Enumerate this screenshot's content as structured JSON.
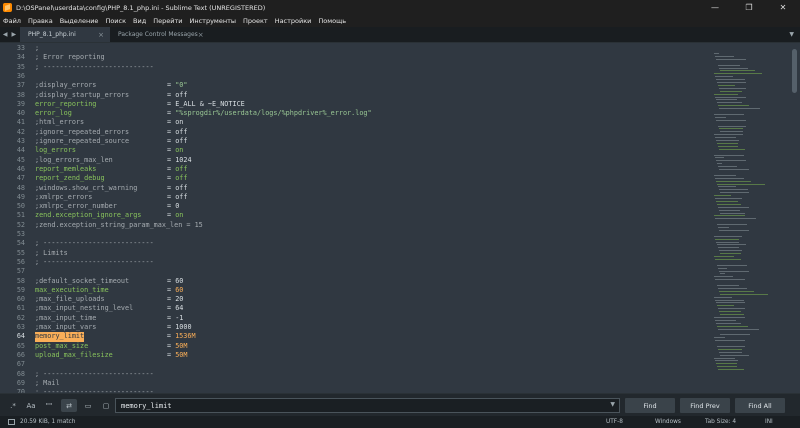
{
  "window": {
    "title": "D:\\OSPanel\\userdata\\config\\PHP_8.1_php.ini - Sublime Text (UNREGISTERED)",
    "controls": [
      "—",
      "❐",
      "✕"
    ]
  },
  "menu": [
    "Файл",
    "Правка",
    "Выделение",
    "Поиск",
    "Вид",
    "Перейти",
    "Инструменты",
    "Проект",
    "Настройки",
    "Помощь"
  ],
  "tabs": [
    {
      "label": "PHP_8.1_php.ini",
      "close": "×"
    },
    {
      "label": "Package Control Messages",
      "close": "×"
    }
  ],
  "tab_nav": "◀ ▶",
  "tab_dropdown": "▼",
  "editor": {
    "line_numbers": [
      "33",
      "34",
      "35",
      "36",
      "37",
      "38",
      "39",
      "40",
      "41",
      "42",
      "43",
      "44",
      "45",
      "46",
      "47",
      "48",
      "49",
      "50",
      "51",
      "52",
      "53",
      "54",
      "55",
      "56",
      "57",
      "58",
      "59",
      "60",
      "61",
      "62",
      "63",
      "64",
      "65",
      "66",
      "67",
      "68",
      "69",
      "70"
    ],
    "lines": [
      {
        "n": "33",
        "key": "",
        "comment": ";",
        "op": "",
        "value": ""
      },
      {
        "n": "34",
        "key": "",
        "comment": "; Error reporting",
        "op": "",
        "value": ""
      },
      {
        "n": "35",
        "key": "",
        "comment": "; ---------------------------",
        "op": "",
        "value": ""
      },
      {
        "n": "36",
        "key": "",
        "comment": "",
        "op": "",
        "value": ""
      },
      {
        "n": "37",
        "key": "",
        "comment": ";display_errors",
        "op": "= ",
        "value": "\"0\""
      },
      {
        "n": "38",
        "key": "",
        "comment": ";display_startup_errors",
        "op": "= ",
        "value": "off"
      },
      {
        "n": "39",
        "key": "error_reporting",
        "comment": "",
        "op": "= ",
        "value": "E_ALL & ~E_NOTICE"
      },
      {
        "n": "40",
        "key": "error_log",
        "comment": "",
        "op": "= ",
        "value": "\"%sprogdir%/userdata/logs/%phpdriver%_error.log\""
      },
      {
        "n": "41",
        "key": "",
        "comment": ";html_errors",
        "op": "= ",
        "value": "on"
      },
      {
        "n": "42",
        "key": "",
        "comment": ";ignore_repeated_errors",
        "op": "= ",
        "value": "off"
      },
      {
        "n": "43",
        "key": "",
        "comment": ";ignore_repeated_source",
        "op": "= ",
        "value": "off"
      },
      {
        "n": "44",
        "key": "log_errors",
        "comment": "",
        "op": "= ",
        "value": "on"
      },
      {
        "n": "45",
        "key": "",
        "comment": ";log_errors_max_len",
        "op": "= ",
        "value": "1024"
      },
      {
        "n": "46",
        "key": "report_memleaks",
        "comment": "",
        "op": "= ",
        "value": "off"
      },
      {
        "n": "47",
        "key": "report_zend_debug",
        "comment": "",
        "op": "= ",
        "value": "off"
      },
      {
        "n": "48",
        "key": "",
        "comment": ";windows.show_crt_warning",
        "op": "= ",
        "value": "off"
      },
      {
        "n": "49",
        "key": "",
        "comment": ";xmlrpc_errors",
        "op": "= ",
        "value": "off"
      },
      {
        "n": "50",
        "key": "",
        "comment": ";xmlrpc_error_number",
        "op": "= ",
        "value": "0"
      },
      {
        "n": "51",
        "key": "zend.exception_ignore_args",
        "comment": "",
        "op": "= ",
        "value": "on"
      },
      {
        "n": "52",
        "key": "",
        "comment": ";zend.exception_string_param_max_len = 15",
        "op": "",
        "value": ""
      },
      {
        "n": "53",
        "key": "",
        "comment": "",
        "op": "",
        "value": ""
      },
      {
        "n": "54",
        "key": "",
        "comment": "; ---------------------------",
        "op": "",
        "value": ""
      },
      {
        "n": "55",
        "key": "",
        "comment": "; Limits",
        "op": "",
        "value": ""
      },
      {
        "n": "56",
        "key": "",
        "comment": "; ---------------------------",
        "op": "",
        "value": ""
      },
      {
        "n": "57",
        "key": "",
        "comment": "",
        "op": "",
        "value": ""
      },
      {
        "n": "58",
        "key": "",
        "comment": ";default_socket_timeout",
        "op": "= ",
        "value": "60"
      },
      {
        "n": "59",
        "key": "max_execution_time",
        "comment": "",
        "op": "= ",
        "value": "60"
      },
      {
        "n": "60",
        "key": "",
        "comment": ";max_file_uploads",
        "op": "= ",
        "value": "20"
      },
      {
        "n": "61",
        "key": "",
        "comment": ";max_input_nesting_level",
        "op": "= ",
        "value": "64"
      },
      {
        "n": "62",
        "key": "",
        "comment": ";max_input_time",
        "op": "= ",
        "value": "-1"
      },
      {
        "n": "63",
        "key": "",
        "comment": ";max_input_vars",
        "op": "= ",
        "value": "1000"
      },
      {
        "n": "64",
        "key": "memory_limit",
        "comment": "",
        "op": "= ",
        "value": "1536M",
        "highlight": true
      },
      {
        "n": "65",
        "key": "post_max_size",
        "comment": "",
        "op": "= ",
        "value": "50M"
      },
      {
        "n": "66",
        "key": "upload_max_filesize",
        "comment": "",
        "op": "= ",
        "value": "50M"
      },
      {
        "n": "67",
        "key": "",
        "comment": "",
        "op": "",
        "value": ""
      },
      {
        "n": "68",
        "key": "",
        "comment": "; ---------------------------",
        "op": "",
        "value": ""
      },
      {
        "n": "69",
        "key": "",
        "comment": "; Mail",
        "op": "",
        "value": ""
      },
      {
        "n": "70",
        "key": "",
        "comment": "; ---------------------------",
        "op": "",
        "value": ""
      }
    ],
    "current_line": "64"
  },
  "findbar": {
    "options": [
      ".*",
      "Aa",
      "\"\"",
      "⇄",
      "▭",
      "▢"
    ],
    "query": "memory_limit",
    "dropdown": "▼",
    "buttons": [
      "Find",
      "Find Prev",
      "Find All"
    ]
  },
  "status": {
    "file_info": "20.59 KiB, 1 match",
    "encoding": "UTF-8",
    "line_endings": "Windows",
    "tab_size": "Tab Size: 4",
    "syntax": "INI"
  },
  "colors": {
    "editor_bg": "#303841",
    "key": "#88c35c",
    "highlight": "#f9ae58",
    "string": "#99c794"
  }
}
